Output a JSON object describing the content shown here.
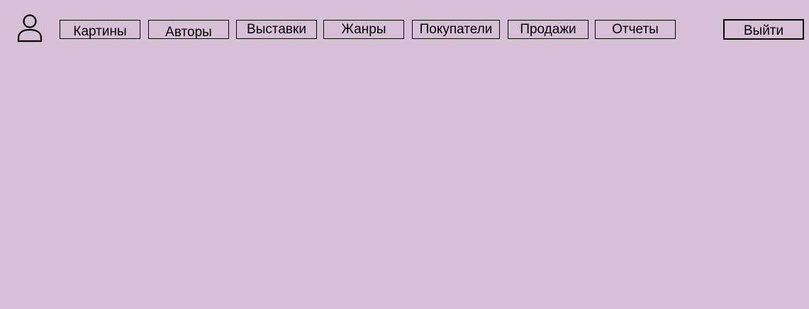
{
  "header": {
    "user_icon": "user-icon",
    "nav": [
      {
        "label": "Картины"
      },
      {
        "label": "Авторы"
      },
      {
        "label": "Выставки"
      },
      {
        "label": "Жанры"
      },
      {
        "label": "Покупатели"
      },
      {
        "label": "Продажи"
      },
      {
        "label": "Отчеты"
      }
    ],
    "logout_label": "Выйти"
  },
  "colors": {
    "background": "#d8bfd8",
    "border": "#000000"
  }
}
